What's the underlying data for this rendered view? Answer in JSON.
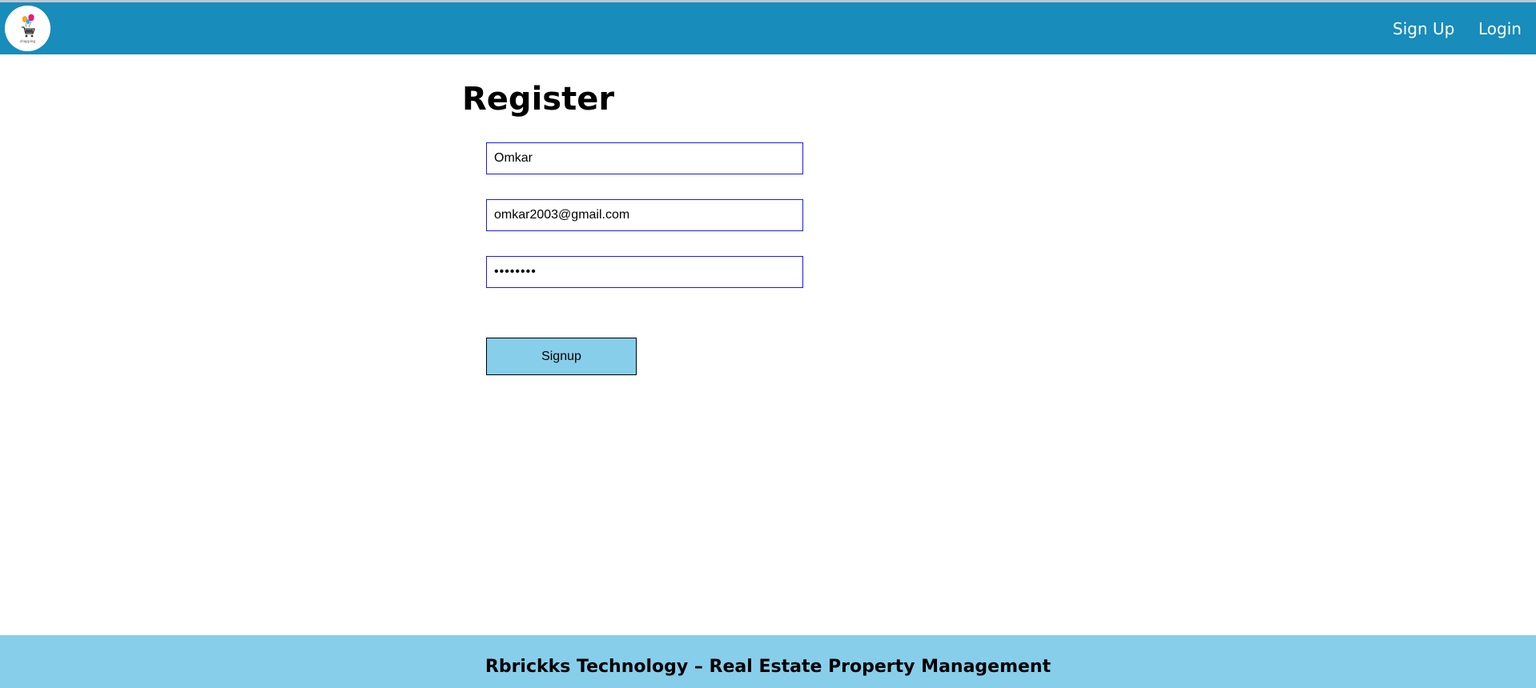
{
  "navbar": {
    "logo_icon": "shopping-cart-balloons-logo",
    "logo_text": "shopping",
    "background_color": "#188cba",
    "links": [
      {
        "label": "Sign Up"
      },
      {
        "label": "Login"
      }
    ]
  },
  "form": {
    "title": "Register",
    "fields": {
      "name": {
        "value": "Omkar"
      },
      "email": {
        "value": "omkar2003@gmail.com"
      },
      "password": {
        "value": "••••••••"
      }
    },
    "field_border_color": "#1a1af0",
    "submit_label": "Signup",
    "submit_color": "#87ceeb"
  },
  "footer": {
    "text": "Rbrickks Technology – Real Estate Property Management",
    "background_color": "#87ceeb"
  }
}
